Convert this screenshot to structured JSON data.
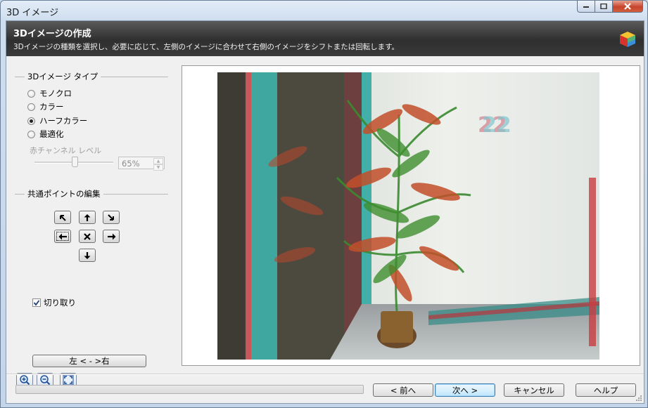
{
  "window": {
    "title": "3D イメージ"
  },
  "header": {
    "title": "3Dイメージの作成",
    "description": "3Dイメージの種類を選択し、必要に応じて、左側のイメージに合わせて右側のイメージをシフトまたは回転します。"
  },
  "image_type": {
    "group_label": "3Dイメージ タイプ",
    "options": [
      {
        "label": "モノクロ",
        "selected": false
      },
      {
        "label": "カラー",
        "selected": false
      },
      {
        "label": "ハーフカラー",
        "selected": true
      },
      {
        "label": "最適化",
        "selected": false
      }
    ],
    "red_channel_label": "赤チャンネル レベル",
    "red_channel_value": "65%",
    "red_channel_level": 0.65
  },
  "common_point": {
    "group_label": "共通ポイントの編集",
    "buttons": [
      "arrow-up-left",
      "arrow-up",
      "arrow-down-right",
      "arrow-left",
      "reset",
      "arrow-right",
      "arrow-down"
    ]
  },
  "crop": {
    "label": "切り取り",
    "checked": true
  },
  "swap_button": "左 < - >右",
  "zoom": {
    "in": "zoom-in",
    "out": "zoom-out",
    "fit": "fit-to-window"
  },
  "footer": {
    "progress": 0,
    "back": "< 前へ",
    "next": "次へ >",
    "cancel": "キャンセル",
    "help": "ヘルプ"
  },
  "colors": {
    "header_bg": "#3a3a3a",
    "accent": "#3c7fb1"
  }
}
